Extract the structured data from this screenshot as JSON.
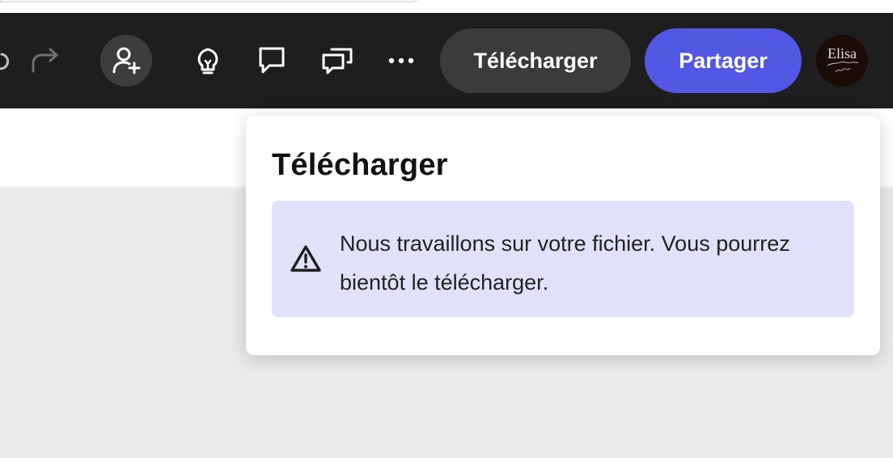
{
  "toolbar": {
    "icons": [
      "undo-icon",
      "redo-icon",
      "invite-user-icon",
      "lightbulb-icon",
      "comment-icon",
      "comments-icon",
      "more-icon"
    ],
    "download_label": "Télécharger",
    "share_label": "Partager",
    "avatar_signature": "Elisa",
    "colors": {
      "background": "#1e1e1e",
      "share": "#5258e4",
      "download": "#3b3b3b"
    }
  },
  "download_popover": {
    "title": "Télécharger",
    "message": "Nous travaillons sur votre fichier. Vous pourrez bientôt le télécharger.",
    "icon": "warning-icon",
    "colors": {
      "alert_background": "#e0e1fb"
    }
  }
}
